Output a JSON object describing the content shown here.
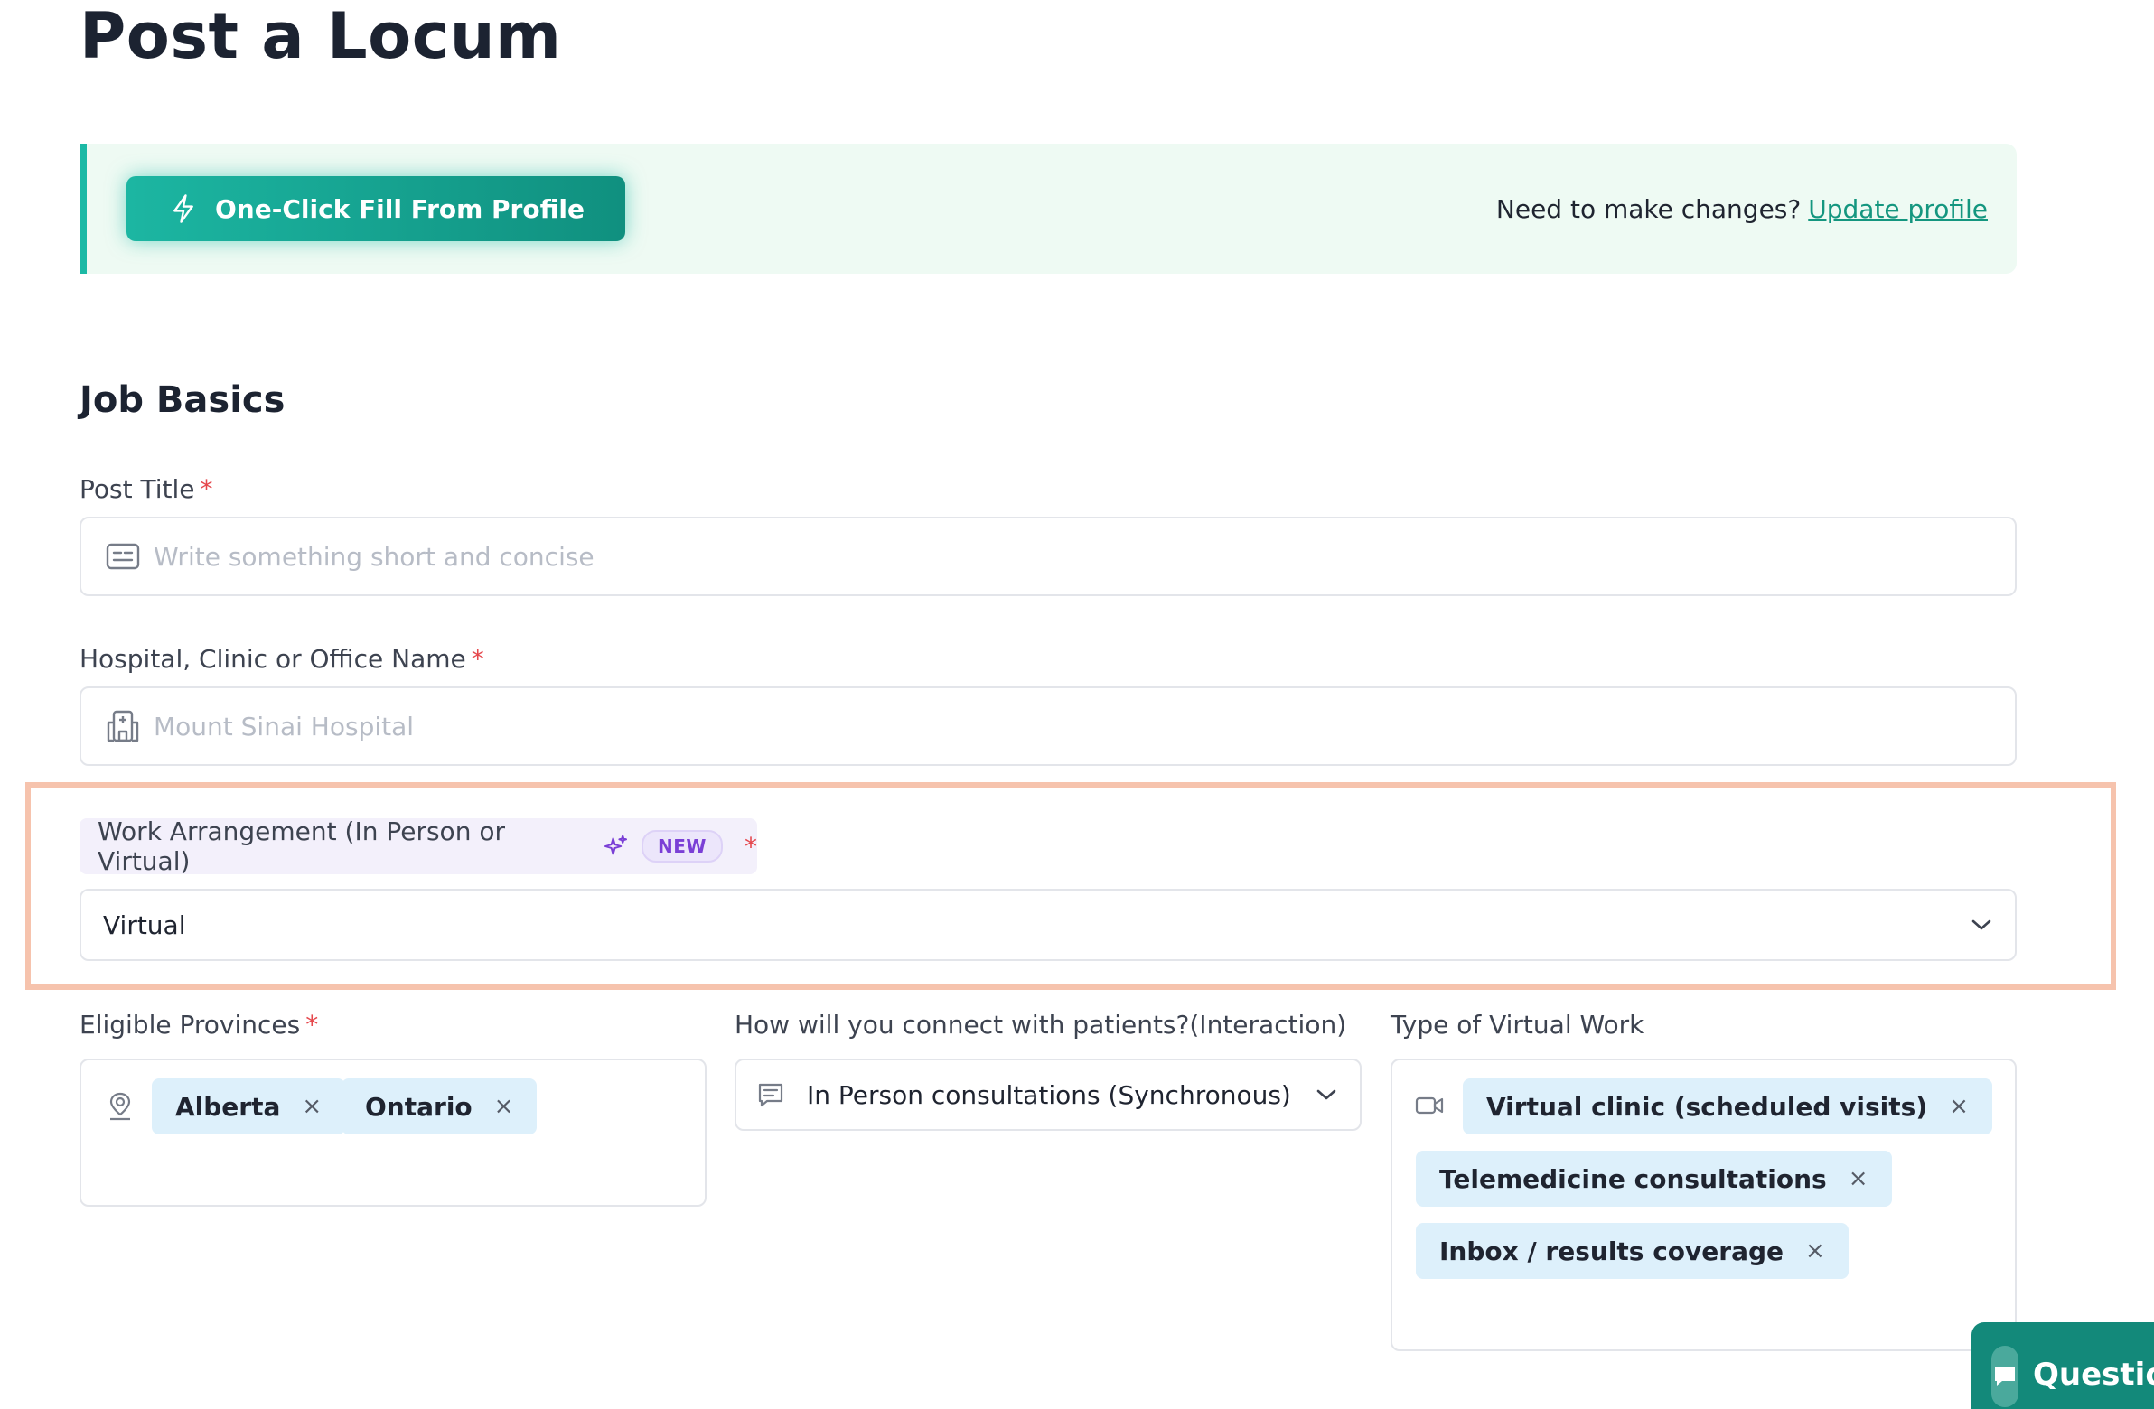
{
  "page": {
    "title": "Post a Locum"
  },
  "banner": {
    "fill_button_label": "One-Click Fill From Profile",
    "changes_text": "Need to make changes?",
    "update_link": "Update profile"
  },
  "section": {
    "title": "Job Basics"
  },
  "post_title": {
    "label": "Post Title",
    "required": "*",
    "placeholder": "Write something short and concise",
    "value": ""
  },
  "hospital": {
    "label": "Hospital, Clinic or Office Name",
    "required": "*",
    "placeholder": "Mount Sinai Hospital",
    "value": ""
  },
  "work_arrangement": {
    "label": "Work Arrangement (In Person or Virtual)",
    "badge": "NEW",
    "required": "*",
    "selected": "Virtual"
  },
  "provinces": {
    "label": "Eligible Provinces",
    "required": "*",
    "chips": [
      "Alberta",
      "Ontario"
    ]
  },
  "interaction": {
    "label": "How will you connect with patients?(Interaction)",
    "selected": "In Person consultations (Synchronous)"
  },
  "virtual_work": {
    "label": "Type of Virtual Work",
    "chips": [
      "Virtual clinic (scheduled visits)",
      "Telemedicine consultations",
      "Inbox / results coverage"
    ]
  },
  "chat": {
    "label": "Questions"
  },
  "chip_remove_glyph": "×",
  "icons": {
    "fill": "lightning-bolt-icon",
    "post_title": "id-card-icon",
    "hospital": "hospital-building-icon",
    "work_arrangement": "sparkle-icon",
    "provinces": "map-pin-user-icon",
    "interaction": "message-lines-icon",
    "virtual_work": "video-camera-icon",
    "select": "chevron-down-icon",
    "chat": "chat-bubble-icon"
  },
  "colors": {
    "accent": "#1bb9a5",
    "accent_dark": "#10907f",
    "banner_bg": "#eefaf3",
    "link": "#14967f",
    "required": "#e5484d",
    "chip_bg": "#ddf0fb",
    "badge_text": "#7a3fd6",
    "highlight_border": "#f6c3ad"
  }
}
